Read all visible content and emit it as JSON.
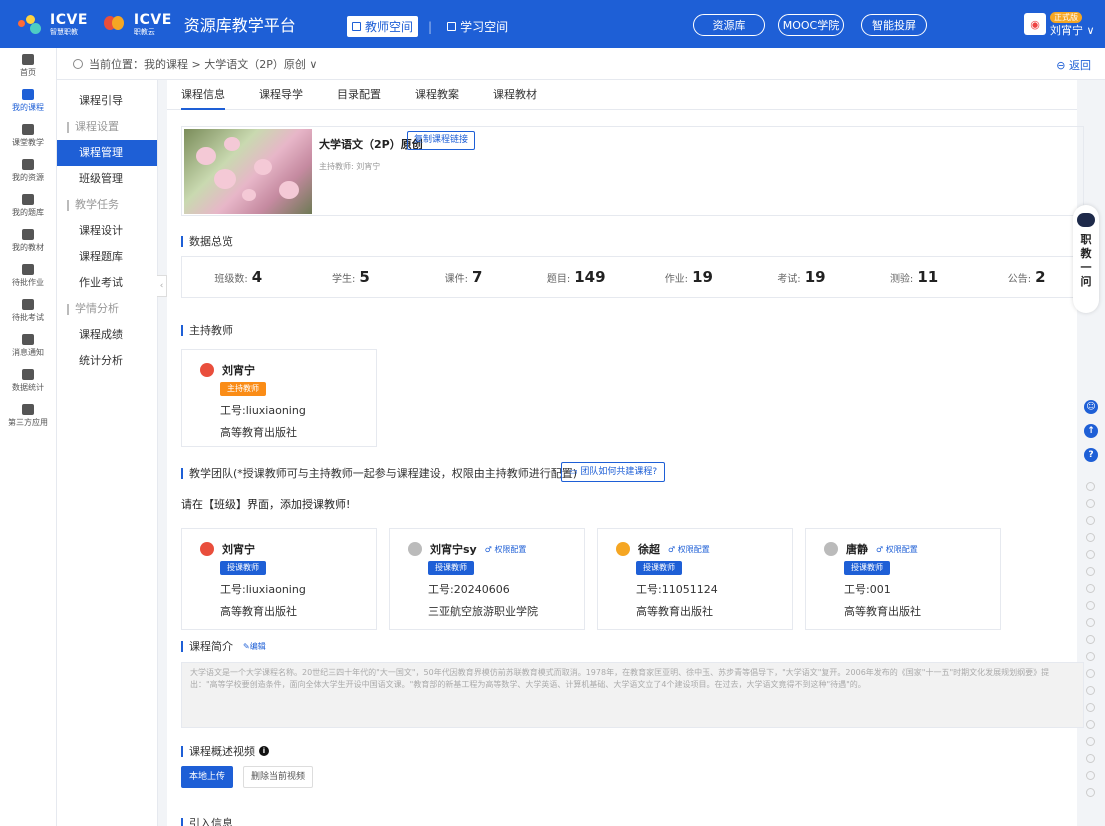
{
  "topbar": {
    "brand1": "icve",
    "brand1_sub": "智慧职教",
    "brand2": "icve",
    "brand2_sub": "职教云",
    "platform": "资源库教学平台",
    "spaces": [
      "教师空间",
      "学习空间"
    ],
    "pills": [
      "资源库",
      "MOOC学院",
      "智能投屏"
    ],
    "user_badge": "正式版",
    "user_name": "刘宵宁"
  },
  "rail": [
    {
      "label": "首页",
      "icon": "home-icon"
    },
    {
      "label": "我的课程",
      "icon": "courses-icon"
    },
    {
      "label": "课堂教学",
      "icon": "classroom-icon"
    },
    {
      "label": "我的资源",
      "icon": "resources-icon"
    },
    {
      "label": "我的题库",
      "icon": "question-bank-icon"
    },
    {
      "label": "我的教材",
      "icon": "textbook-icon"
    },
    {
      "label": "待批作业",
      "icon": "homework-icon"
    },
    {
      "label": "待批考试",
      "icon": "exam-icon"
    },
    {
      "label": "消息通知",
      "icon": "message-icon"
    },
    {
      "label": "数据统计",
      "icon": "stats-icon"
    },
    {
      "label": "第三方应用",
      "icon": "apps-icon"
    }
  ],
  "breadcrumb": {
    "text": "当前位置：我的课程 > 大学语文（2P）原创 ∨",
    "back": "返回"
  },
  "submenu": {
    "guide": "课程引导",
    "group1": "课程设置",
    "g1_items": [
      "课程管理",
      "班级管理"
    ],
    "group2": "教学任务",
    "g2_items": [
      "课程设计",
      "课程题库",
      "作业考试"
    ],
    "group3": "学情分析",
    "g3_items": [
      "课程成绩",
      "统计分析"
    ]
  },
  "tabs": [
    "课程信息",
    "课程导学",
    "目录配置",
    "课程教案",
    "课程教材"
  ],
  "course": {
    "title": "大学语文（2P）原创",
    "copy_link": "复制课程链接",
    "host": "主持教师: 刘宵宁"
  },
  "overview": {
    "title": "数据总览",
    "stats": [
      {
        "label": "班级数:",
        "value": "4"
      },
      {
        "label": "学生:",
        "value": "5"
      },
      {
        "label": "课件:",
        "value": "7"
      },
      {
        "label": "题目:",
        "value": "149"
      },
      {
        "label": "作业:",
        "value": "19"
      },
      {
        "label": "考试:",
        "value": "19"
      },
      {
        "label": "测验:",
        "value": "11"
      },
      {
        "label": "公告:",
        "value": "2"
      }
    ]
  },
  "host_section": {
    "title": "主持教师",
    "name": "刘宵宁",
    "role": "主持教师",
    "id": "工号:liuxiaoning",
    "org": "高等教育出版社"
  },
  "team": {
    "title": "教学团队(*授课教师可与主持教师一起参与课程建设，权限由主持教师进行配置)",
    "tip_btn": "团队如何共建课程?",
    "hint": "请在【班级】界面，添加授课教师!",
    "members": [
      {
        "name": "刘宵宁",
        "perm": "",
        "role": "授课教师",
        "id": "工号:liuxiaoning",
        "org": "高等教育出版社"
      },
      {
        "name": "刘宵宁sy",
        "perm": "权限配置",
        "role": "授课教师",
        "id": "工号:20240606",
        "org": "三亚航空旅游职业学院"
      },
      {
        "name": "徐超",
        "perm": "权限配置",
        "role": "授课教师",
        "id": "工号:11051124",
        "org": "高等教育出版社"
      },
      {
        "name": "唐静",
        "perm": "权限配置",
        "role": "授课教师",
        "id": "工号:001",
        "org": "高等教育出版社"
      }
    ]
  },
  "intro": {
    "title": "课程简介",
    "edit": "编辑",
    "text": "大学语文是一个大学课程名称。20世纪三四十年代的\"大一国文\"，50年代因教育界模仿前苏联教育模式而取消。1978年，在教育家匡亚明、徐中玉、苏步青等倡导下，\"大学语文\"复开。2006年发布的《国家\"十一五\"时期文化发展规划纲要》提出：\"高等学校要创造条件，面向全体大学生开设中国语文课。\"教育部的新基工程为高等数学、大学英语、计算机基础、大学语文立了4个建设项目。在过去，大学语文竟得不到这种\"待遇\"的。"
  },
  "video": {
    "title": "课程概述视频",
    "upload": "本地上传",
    "delete": "删除当前视频"
  },
  "import": {
    "title": "引入信息"
  },
  "robot": {
    "text": "职教一问"
  },
  "colors": {
    "primary": "#1e5fd6",
    "host_tag": "#fa8c16",
    "teacher_tag": "#1e5fd6"
  }
}
